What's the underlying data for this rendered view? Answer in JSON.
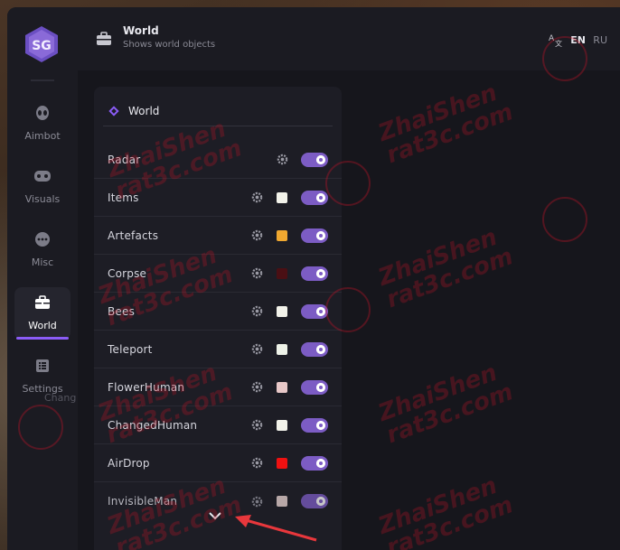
{
  "header": {
    "title": "World",
    "subtitle": "Shows world objects",
    "languages": [
      "EN",
      "RU"
    ],
    "active_language": "EN"
  },
  "sidebar": {
    "items": [
      {
        "label": "Aimbot",
        "icon": "alien-icon"
      },
      {
        "label": "Visuals",
        "icon": "gamepad-icon"
      },
      {
        "label": "Misc",
        "icon": "dots-icon"
      },
      {
        "label": "World",
        "icon": "briefcase-icon",
        "active": true
      },
      {
        "label": "Settings",
        "icon": "list-icon"
      }
    ],
    "ghost_text": "Chang"
  },
  "section": {
    "title": "World"
  },
  "rows": [
    {
      "label": "Radar",
      "color": null,
      "enabled": true
    },
    {
      "label": "Items",
      "color": "#f2f2ea",
      "enabled": true
    },
    {
      "label": "Artefacts",
      "color": "#f0a830",
      "enabled": true
    },
    {
      "label": "Corpse",
      "color": "#4a0f14",
      "enabled": true
    },
    {
      "label": "Bees",
      "color": "#f2f2ea",
      "enabled": true
    },
    {
      "label": "Teleport",
      "color": "#eef2e8",
      "enabled": true
    },
    {
      "label": "FlowerHuman",
      "color": "#e8c8c8",
      "enabled": true
    },
    {
      "label": "ChangedHuman",
      "color": "#f2f2ea",
      "enabled": true
    },
    {
      "label": "AirDrop",
      "color": "#ee1111",
      "enabled": true
    },
    {
      "label": "InvisibleMan",
      "color": "#b8a8a8",
      "enabled": true
    }
  ],
  "colors": {
    "accent": "#8b5cf6",
    "toggle_on": "#7c5cc4",
    "annotation_arrow": "#e8373c"
  },
  "watermark": {
    "line1": "ZhaiShen",
    "line2": "rat3c.com"
  }
}
